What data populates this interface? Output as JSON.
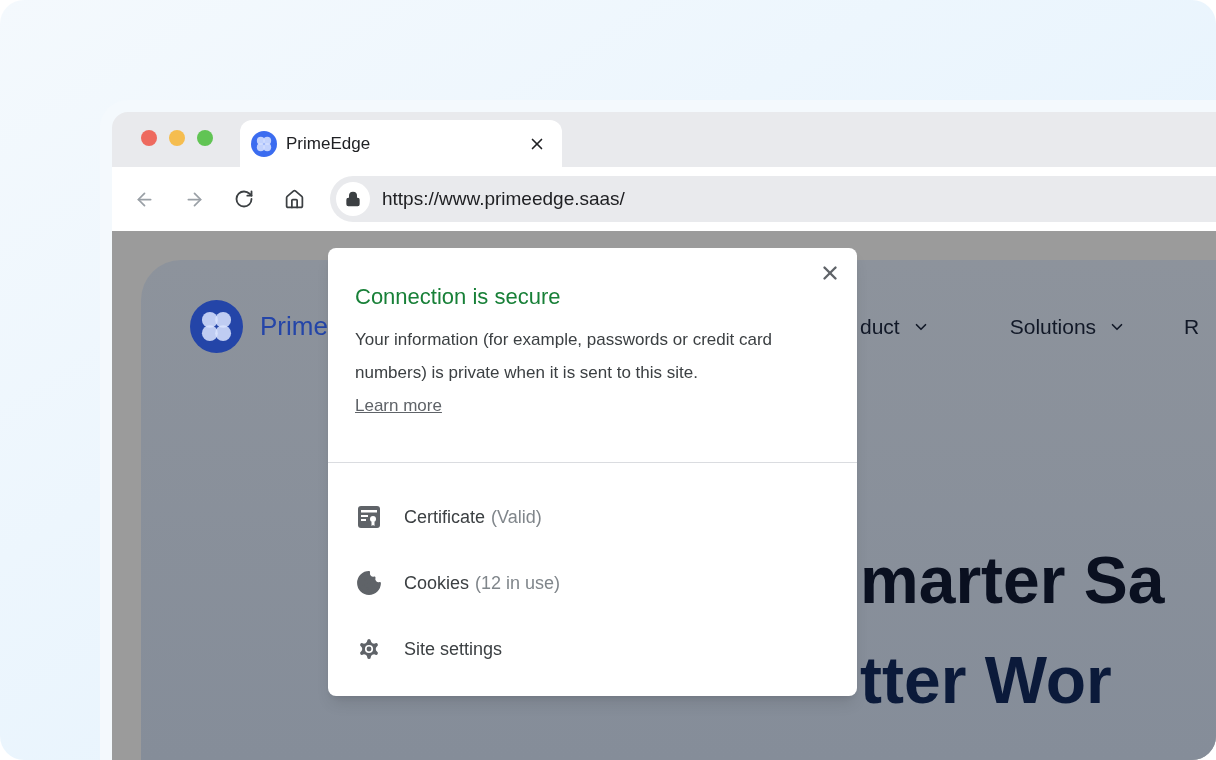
{
  "browser": {
    "tab": {
      "title": "PrimeEdge",
      "selected": true
    },
    "address": {
      "url": "https://www.primeedge.saas/"
    }
  },
  "page": {
    "brand": "Prime",
    "nav": [
      {
        "label": "duct",
        "has_menu": true
      },
      {
        "label": "Solutions",
        "has_menu": true
      },
      {
        "label": "R",
        "has_menu": false
      }
    ],
    "hero": [
      "marter Sa",
      "tter Wor"
    ]
  },
  "popup": {
    "title": "Connection is secure",
    "body": "Your information (for example, passwords or credit card numbers) is private when it is sent to this site.",
    "link": "Learn more",
    "items": [
      {
        "kind": "certificate",
        "label": "Certificate",
        "detail": "(Valid)"
      },
      {
        "kind": "cookies",
        "label": "Cookies",
        "detail": "(12 in use)"
      },
      {
        "kind": "settings",
        "label": "Site settings"
      }
    ]
  }
}
